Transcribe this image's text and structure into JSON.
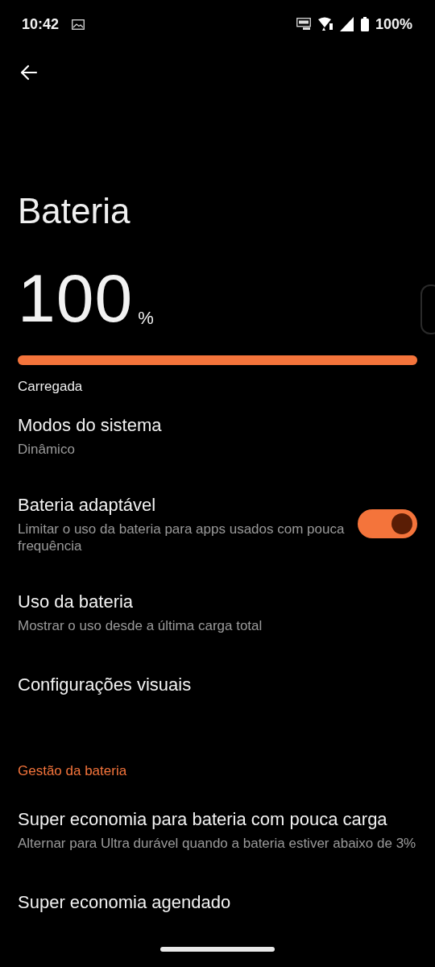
{
  "status_bar": {
    "time": "10:42",
    "battery": "100%"
  },
  "title": "Bateria",
  "battery": {
    "percent": "100",
    "unit": "%",
    "level": 1,
    "state": "Carregada"
  },
  "items": [
    {
      "kind": "plain",
      "title": "Modos do sistema",
      "subtitle": "Dinâmico"
    },
    {
      "kind": "switch",
      "title": "Bateria adaptável",
      "subtitle": "Limitar o uso da bateria para apps usados com pouca frequência",
      "on": true
    },
    {
      "kind": "plain",
      "title": "Uso da bateria",
      "subtitle": "Mostrar o uso desde a última carga total"
    },
    {
      "kind": "plain",
      "title": "Configurações visuais"
    },
    {
      "kind": "header",
      "title": "Gestão da bateria"
    },
    {
      "kind": "plain",
      "title": "Super economia para bateria com pouca carga",
      "subtitle": "Alternar para Ultra durável quando a bateria estiver abaixo de 3%"
    },
    {
      "kind": "plain",
      "title": "Super economia agendado"
    }
  ]
}
